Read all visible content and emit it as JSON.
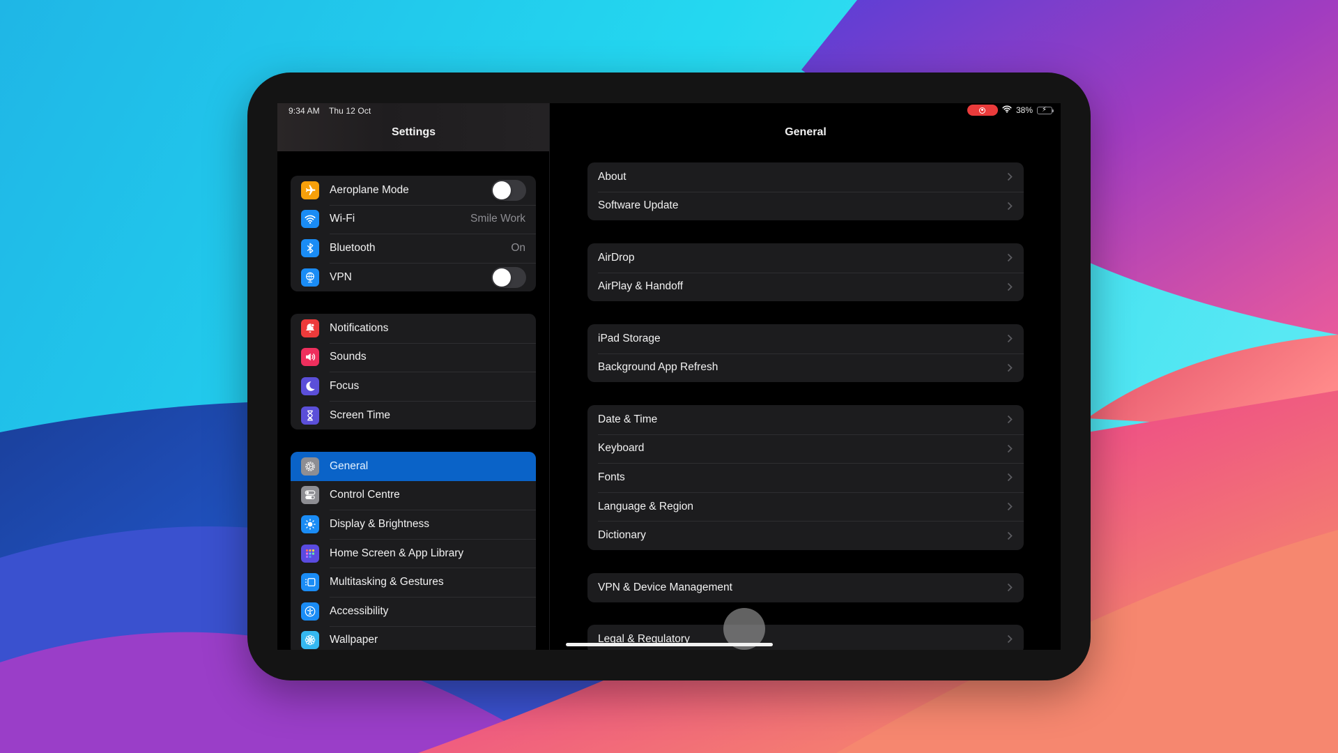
{
  "status_bar": {
    "time": "9:34 AM",
    "date": "Thu 12 Oct",
    "battery_percent_label": "38%",
    "battery_level": 0.38,
    "charging": true,
    "screen_recording": true
  },
  "sidebar": {
    "title": "Settings",
    "groups": [
      {
        "items": [
          {
            "label": "Aeroplane Mode",
            "icon": "airplane-icon",
            "color": "#f7a00b",
            "control": "toggle",
            "toggle_on": false
          },
          {
            "label": "Wi-Fi",
            "icon": "wifi-icon",
            "color": "#1a8cf5",
            "value": "Smile Work"
          },
          {
            "label": "Bluetooth",
            "icon": "bluetooth-icon",
            "color": "#1a8cf5",
            "value": "On"
          },
          {
            "label": "VPN",
            "icon": "vpn-globe-icon",
            "color": "#1a8cf5",
            "control": "toggle",
            "toggle_on": false
          }
        ]
      },
      {
        "items": [
          {
            "label": "Notifications",
            "icon": "bell-icon",
            "color": "#ed3b3b"
          },
          {
            "label": "Sounds",
            "icon": "speaker-icon",
            "color": "#ee2f5d"
          },
          {
            "label": "Focus",
            "icon": "moon-icon",
            "color": "#5b4fd9"
          },
          {
            "label": "Screen Time",
            "icon": "hourglass-icon",
            "color": "#5b4fd9"
          }
        ]
      },
      {
        "items": [
          {
            "label": "General",
            "icon": "gear-icon",
            "color": "#8e8e93",
            "selected": true
          },
          {
            "label": "Control Centre",
            "icon": "switches-icon",
            "color": "#8e8e93"
          },
          {
            "label": "Display & Brightness",
            "icon": "sun-icon",
            "color": "#1a8cf5"
          },
          {
            "label": "Home Screen & App Library",
            "icon": "app-grid-icon",
            "color": "#5a4be0"
          },
          {
            "label": "Multitasking & Gestures",
            "icon": "multitasking-icon",
            "color": "#1a8cf5"
          },
          {
            "label": "Accessibility",
            "icon": "accessibility-icon",
            "color": "#1a8cf5"
          },
          {
            "label": "Wallpaper",
            "icon": "flower-icon",
            "color": "#35b8f0"
          }
        ]
      }
    ]
  },
  "detail": {
    "title": "General",
    "groups": [
      {
        "items": [
          {
            "label": "About"
          },
          {
            "label": "Software Update"
          }
        ]
      },
      {
        "items": [
          {
            "label": "AirDrop"
          },
          {
            "label": "AirPlay & Handoff"
          }
        ]
      },
      {
        "items": [
          {
            "label": "iPad Storage"
          },
          {
            "label": "Background App Refresh"
          }
        ]
      },
      {
        "items": [
          {
            "label": "Date & Time"
          },
          {
            "label": "Keyboard"
          },
          {
            "label": "Fonts"
          },
          {
            "label": "Language & Region"
          },
          {
            "label": "Dictionary"
          }
        ]
      },
      {
        "items": [
          {
            "label": "VPN & Device Management"
          }
        ]
      },
      {
        "items": [
          {
            "label": "Legal & Regulatory"
          }
        ]
      }
    ]
  }
}
